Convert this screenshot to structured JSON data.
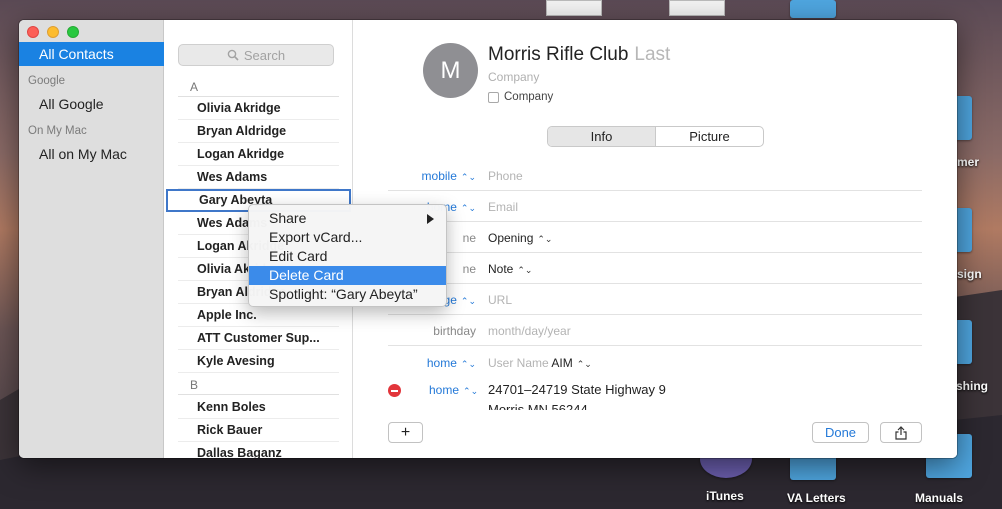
{
  "desktop": {
    "icons": [
      {
        "label": "mer"
      },
      {
        "label": "sign"
      },
      {
        "label": "shing"
      },
      {
        "label": "iTunes"
      },
      {
        "label": "VA Letters"
      },
      {
        "label": "Manuals"
      }
    ]
  },
  "sidebar": {
    "items": [
      {
        "label": "All Contacts",
        "selected": true
      },
      {
        "header": "Google"
      },
      {
        "label": "All Google"
      },
      {
        "header": "On My Mac"
      },
      {
        "label": "All on My Mac"
      }
    ]
  },
  "list": {
    "search_placeholder": "Search",
    "sections": [
      {
        "letter": "A",
        "contacts": [
          "Olivia Akridge",
          "Bryan Aldridge",
          "Logan Akridge",
          "Wes Adams",
          "Gary Abeyta",
          "Wes Adams",
          "Logan Akridge",
          "Olivia Akridge",
          "Bryan Aldridge",
          "Apple Inc.",
          "ATT Customer Sup...",
          "Kyle Avesing"
        ]
      },
      {
        "letter": "B",
        "contacts": [
          "Kenn Boles",
          "Rick Bauer",
          "Dallas Baganz"
        ]
      }
    ],
    "focused_contact": "Gary Abeyta"
  },
  "context_menu": {
    "items": [
      {
        "label": "Share",
        "submenu": true
      },
      {
        "label": "Export vCard..."
      },
      {
        "label": "Edit Card"
      },
      {
        "label": "Delete Card",
        "highlighted": true
      },
      {
        "label": "Spotlight: “Gary Abeyta”"
      }
    ]
  },
  "detail": {
    "avatar_initial": "M",
    "first_name": "Morris Rifle Club",
    "last_placeholder": "Last",
    "company_placeholder": "Company",
    "company_checkbox_label": "Company",
    "tabs": [
      "Info",
      "Picture"
    ],
    "fields": [
      {
        "label": "mobile",
        "value": "Phone"
      },
      {
        "label": "home",
        "value": "Email"
      },
      {
        "label": "ne",
        "value": "Opening"
      },
      {
        "label": "ne",
        "value": "Note"
      },
      {
        "label": "ge",
        "value": "URL"
      },
      {
        "label": "birthday",
        "value": "month/day/year"
      },
      {
        "label": "home",
        "value": "User Name",
        "service": "AIM"
      }
    ],
    "address": {
      "label": "home",
      "line1": "24701–24719 State Highway 9",
      "line2": "Morris MN 56244"
    },
    "done_label": "Done",
    "add_label": "+"
  },
  "colors": {
    "accent": "#1a82e2",
    "link": "#2479d8",
    "highlight": "#3b8bea",
    "remove": "#e2353b"
  }
}
